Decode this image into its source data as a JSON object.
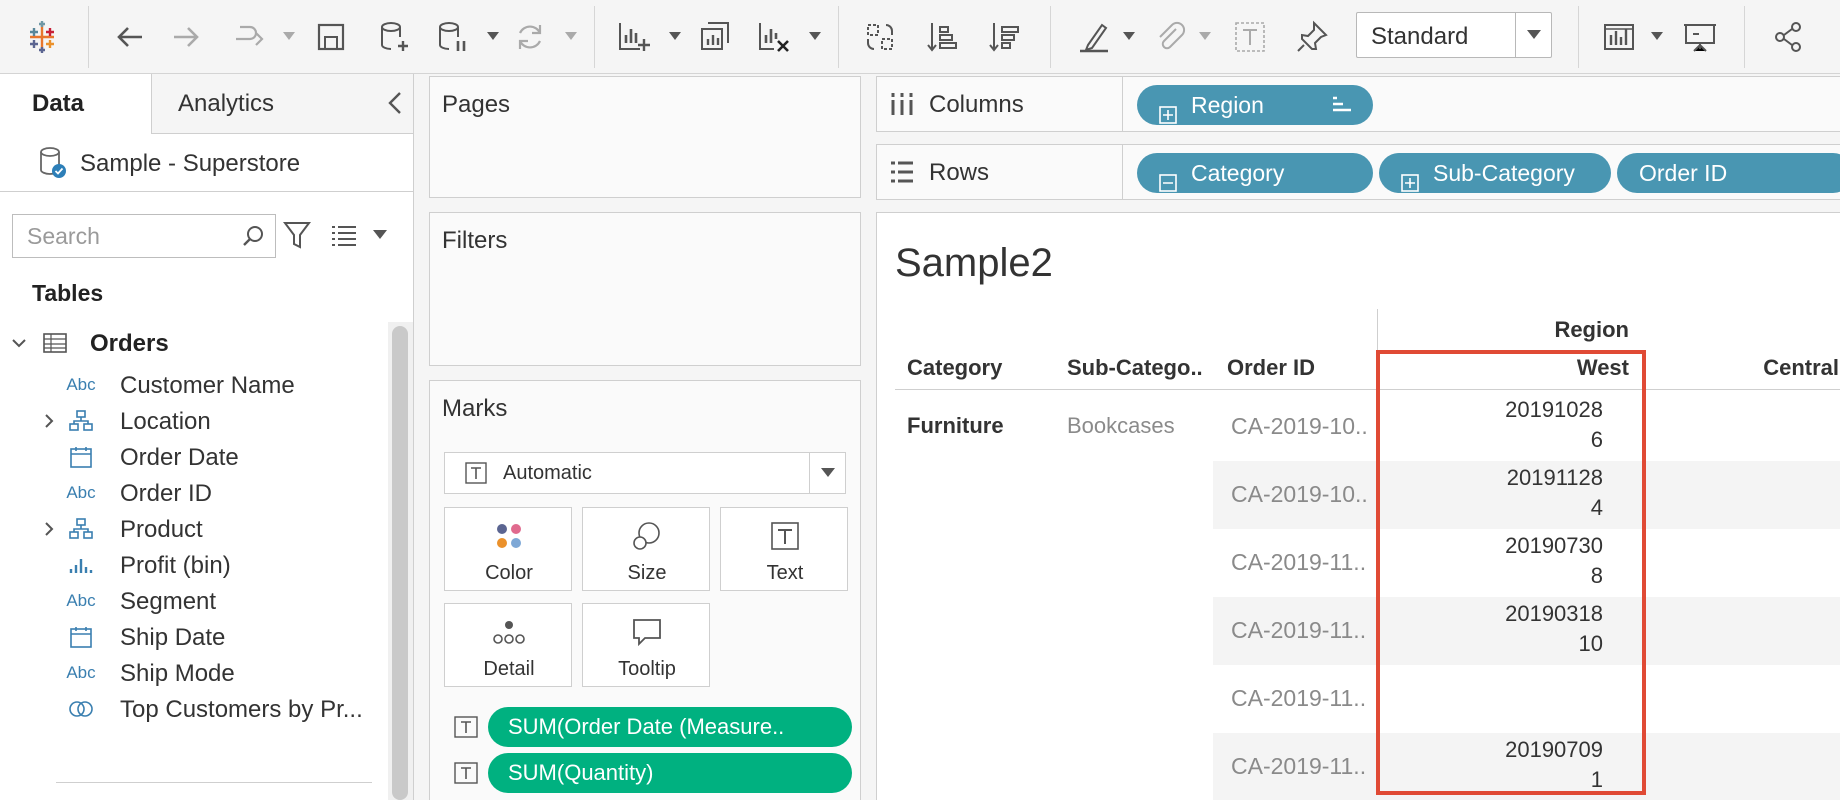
{
  "toolbar": {
    "view_select": "Standard",
    "icons": [
      "tableau-logo-icon",
      "back-icon",
      "forward-icon",
      "redo-icon",
      "save-icon",
      "new-data-source-icon",
      "pause-updates-icon",
      "refresh-icon",
      "new-worksheet-icon",
      "duplicate-icon",
      "clear-sheet-icon",
      "swap-icon",
      "sort-ascending-icon",
      "sort-descending-icon",
      "highlight-icon",
      "attach-icon",
      "text-icon",
      "pin-icon",
      "show-me-icon",
      "presentation-icon",
      "share-icon"
    ]
  },
  "data_pane": {
    "tab_data": "Data",
    "tab_analytics": "Analytics",
    "datasource": "Sample - Superstore",
    "search_placeholder": "Search",
    "tables_heading": "Tables",
    "table_name": "Orders",
    "field_abc": "Abc",
    "fields": [
      {
        "label": "Customer Name",
        "type": "abc"
      },
      {
        "label": "Location",
        "type": "hierarchy"
      },
      {
        "label": "Order Date",
        "type": "date"
      },
      {
        "label": "Order ID",
        "type": "abc"
      },
      {
        "label": "Product",
        "type": "hierarchy"
      },
      {
        "label": "Profit (bin)",
        "type": "bin"
      },
      {
        "label": "Segment",
        "type": "abc"
      },
      {
        "label": "Ship Date",
        "type": "date"
      },
      {
        "label": "Ship Mode",
        "type": "abc"
      },
      {
        "label": "Top Customers by Pr...",
        "type": "set"
      }
    ]
  },
  "shelves": {
    "pages_title": "Pages",
    "filters_title": "Filters",
    "marks_title": "Marks",
    "mark_type": "Automatic",
    "mark_buttons": [
      "Color",
      "Size",
      "Text",
      "Detail",
      "Tooltip"
    ],
    "mark_pills": [
      "SUM(Order Date (Measure..",
      "SUM(Quantity)"
    ],
    "columns_label": "Columns",
    "rows_label": "Rows",
    "columns_pills": [
      "Region"
    ],
    "rows_pills": [
      "Category",
      "Sub-Category",
      "Order ID"
    ]
  },
  "view": {
    "title": "Sample2",
    "region_header": "Region",
    "col_headers": [
      "Category",
      "Sub-Catego..",
      "Order ID",
      "West",
      "Central"
    ],
    "category": "Furniture",
    "subcategory": "Bookcases",
    "rows": [
      {
        "order_id": "CA-2019-10..",
        "west_date": "20191028",
        "west_qty": "6"
      },
      {
        "order_id": "CA-2019-10..",
        "west_date": "20191128",
        "west_qty": "4"
      },
      {
        "order_id": "CA-2019-11..",
        "west_date": "20190730",
        "west_qty": "8"
      },
      {
        "order_id": "CA-2019-11..",
        "west_date": "20190318",
        "west_qty": "10"
      },
      {
        "order_id": "CA-2019-11..",
        "west_date": "",
        "west_qty": ""
      },
      {
        "order_id": "CA-2019-11..",
        "west_date": "20190709",
        "west_qty": "1"
      }
    ]
  },
  "colors": {
    "dimension_pill": "#4996b2",
    "measure_pill": "#00b180",
    "highlight": "#e04a35"
  }
}
